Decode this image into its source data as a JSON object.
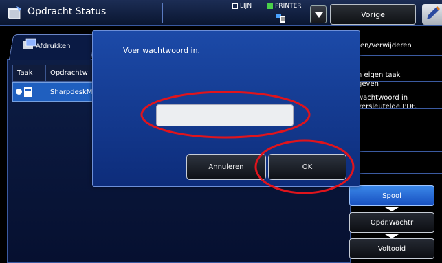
{
  "header": {
    "title": "Opdracht Status",
    "indicators": [
      {
        "label": "LIJN",
        "active": false
      },
      {
        "label": "PRINTER",
        "active": true
      }
    ],
    "back_label": "Vorige",
    "title_icon": "job-status-icon",
    "corner_icon": "pen-icon"
  },
  "job_panel": {
    "tab_label": "Afdrukken",
    "tab_icon": "print-icon",
    "columns": [
      "Taak",
      "Opdrachtw"
    ],
    "selected_row": {
      "name": "SharpdeskM"
    }
  },
  "right_menu": {
    "items": [
      "ten/Verwijderen",
      "n eigen taak\ngeven",
      "wachtwoord in\nversleutelde PDF."
    ]
  },
  "status_buttons": [
    {
      "label": "Spool",
      "active": true
    },
    {
      "label": "Opdr.Wachtr",
      "active": false
    },
    {
      "label": "Voltooid",
      "active": false
    }
  ],
  "dialog": {
    "prompt": "Voer wachtwoord in.",
    "password_value": "",
    "cancel_label": "Annuleren",
    "ok_label": "OK"
  },
  "colors": {
    "dialog_bg": "#1c4aa8",
    "active_button": "#2a6fd8",
    "annotation": "#e0141c",
    "background": "#000000"
  }
}
